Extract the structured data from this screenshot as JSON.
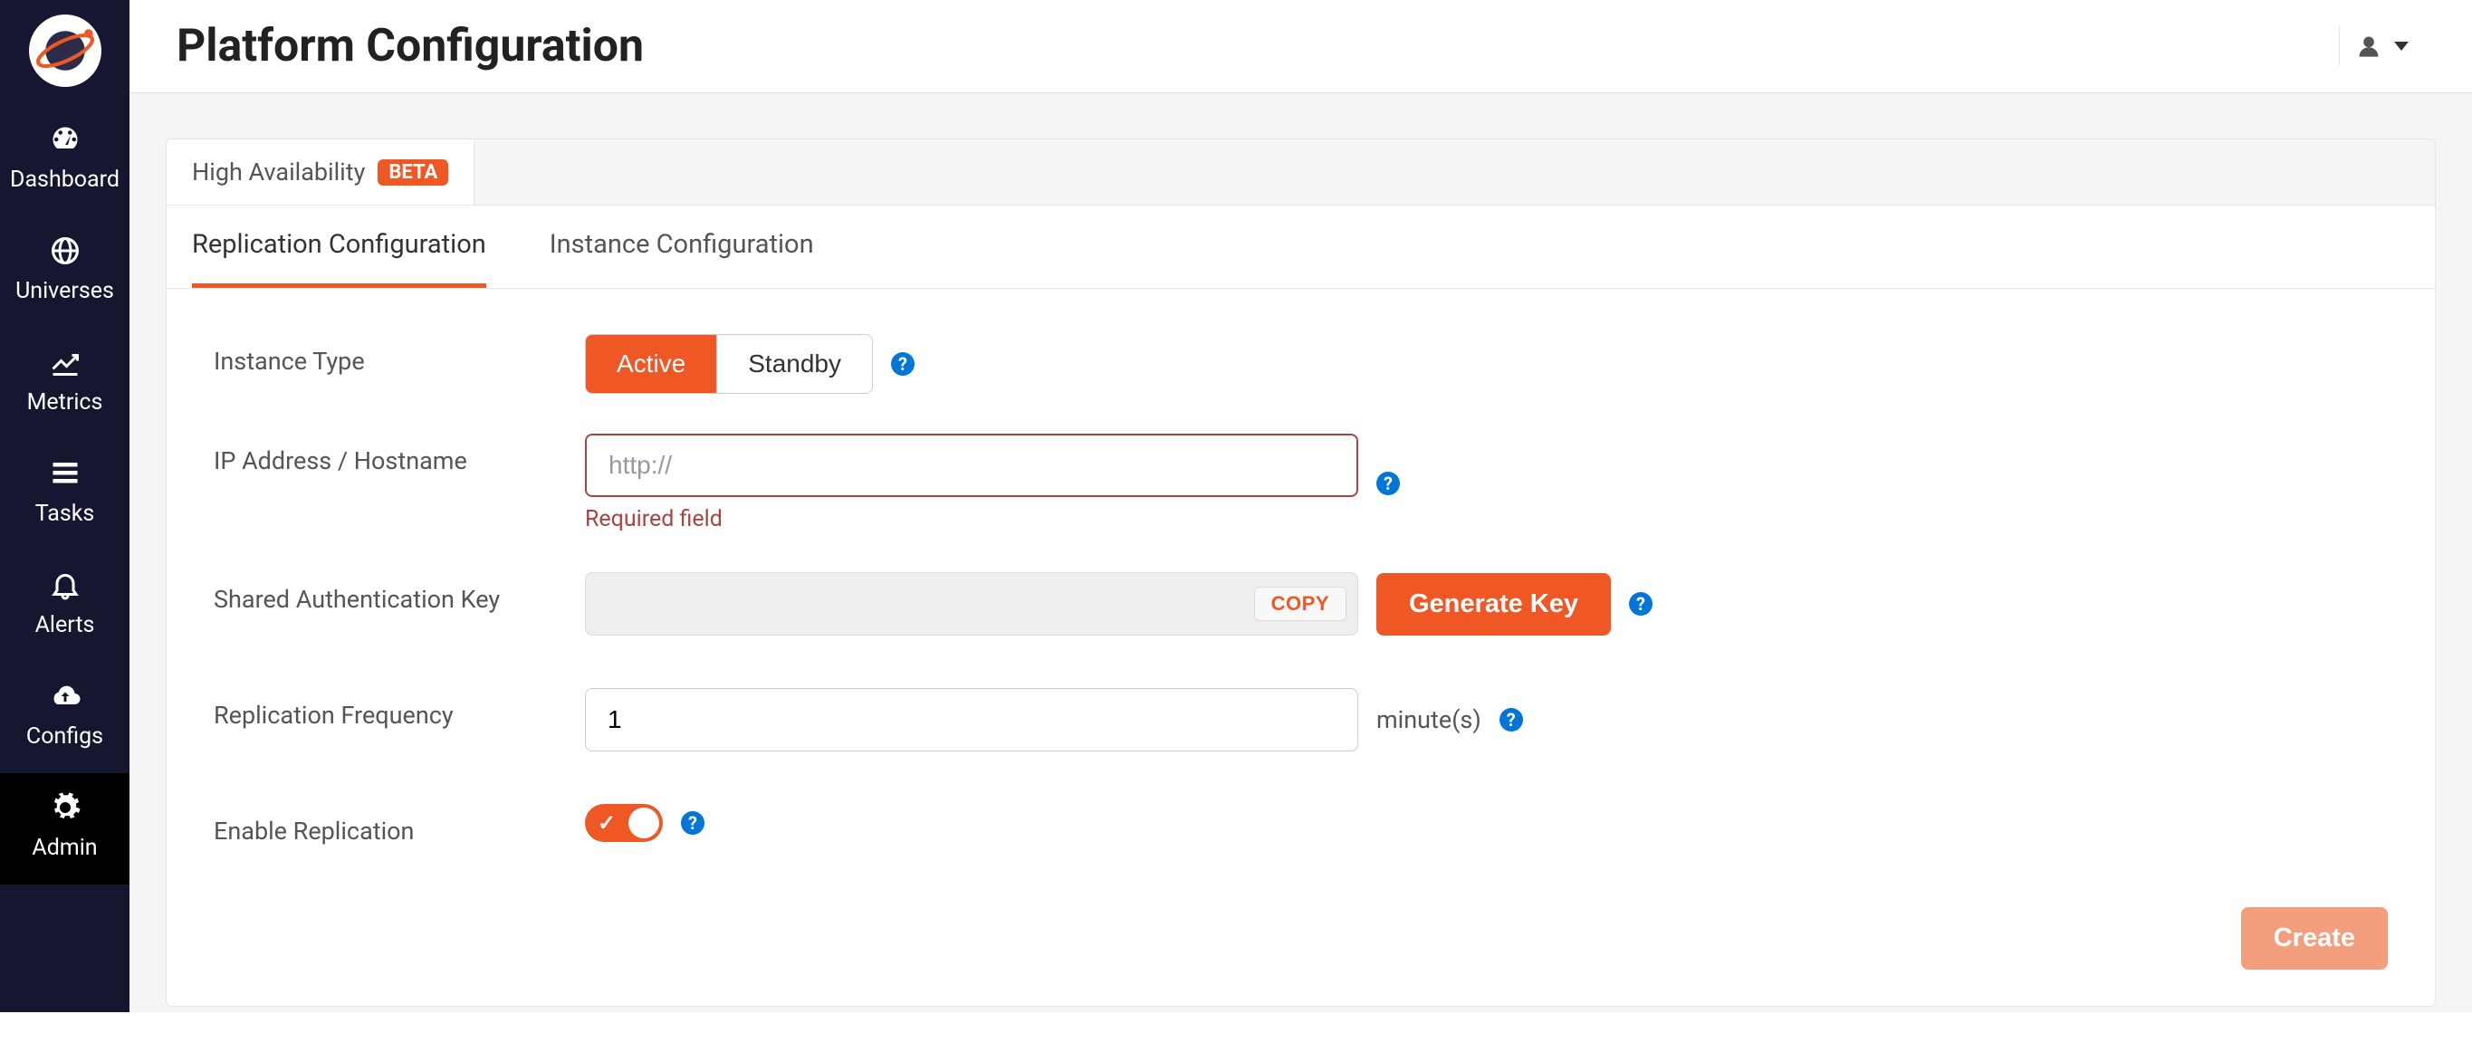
{
  "header": {
    "title": "Platform Configuration"
  },
  "sidebar": {
    "items": [
      {
        "name": "dashboard",
        "label": "Dashboard"
      },
      {
        "name": "universes",
        "label": "Universes"
      },
      {
        "name": "metrics",
        "label": "Metrics"
      },
      {
        "name": "tasks",
        "label": "Tasks"
      },
      {
        "name": "alerts",
        "label": "Alerts"
      },
      {
        "name": "configs",
        "label": "Configs"
      },
      {
        "name": "admin",
        "label": "Admin"
      }
    ],
    "active": "admin"
  },
  "top_tabs": {
    "ha": {
      "label": "High Availability",
      "badge": "BETA"
    }
  },
  "sub_tabs": {
    "replication": {
      "label": "Replication Configuration"
    },
    "instance": {
      "label": "Instance Configuration"
    },
    "active": "replication"
  },
  "form": {
    "instance_type": {
      "label": "Instance Type",
      "options": {
        "active": "Active",
        "standby": "Standby"
      },
      "selected": "active"
    },
    "ip_hostname": {
      "label": "IP Address / Hostname",
      "placeholder": "http://",
      "value": "",
      "error": "Required field"
    },
    "auth_key": {
      "label": "Shared Authentication Key",
      "value": "",
      "copy_label": "COPY",
      "generate_label": "Generate Key"
    },
    "replication_frequency": {
      "label": "Replication Frequency",
      "value": "1",
      "unit": "minute(s)"
    },
    "enable_replication": {
      "label": "Enable Replication",
      "value": true
    },
    "submit_label": "Create"
  }
}
